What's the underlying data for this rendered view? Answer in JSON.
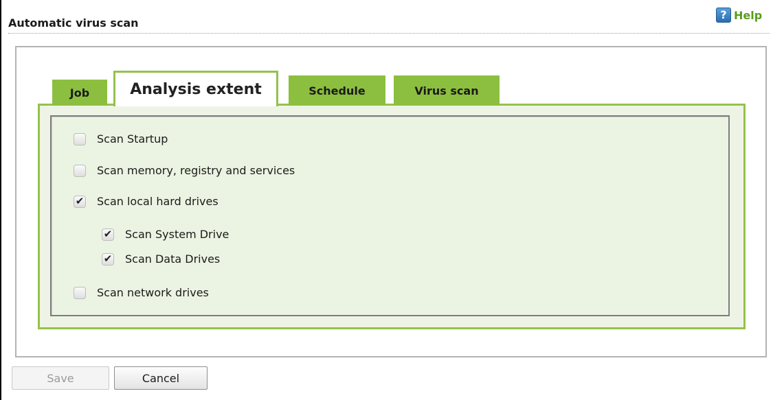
{
  "header": {
    "title": "Automatic virus scan",
    "help_icon_glyph": "?",
    "help_label": "Help"
  },
  "tabs": [
    {
      "label": "Job",
      "active": false
    },
    {
      "label": "Analysis extent",
      "active": true
    },
    {
      "label": "Schedule",
      "active": false
    },
    {
      "label": "Virus scan",
      "active": false
    }
  ],
  "options": [
    {
      "label": "Scan Startup",
      "checked": false
    },
    {
      "label": "Scan memory, registry and services",
      "checked": false
    },
    {
      "label": "Scan local hard drives",
      "checked": true
    },
    {
      "label": "Scan System Drive",
      "checked": true
    },
    {
      "label": "Scan Data Drives",
      "checked": true
    },
    {
      "label": "Scan network drives",
      "checked": false
    }
  ],
  "check_glyph": "✔",
  "buttons": {
    "save_label": "Save",
    "save_disabled": true,
    "cancel_label": "Cancel"
  },
  "colors": {
    "tab_green": "#8cbf3f",
    "frame_green": "#93c24c",
    "panel_bg": "#ebf4e2",
    "help_green": "#5a9c1c"
  }
}
